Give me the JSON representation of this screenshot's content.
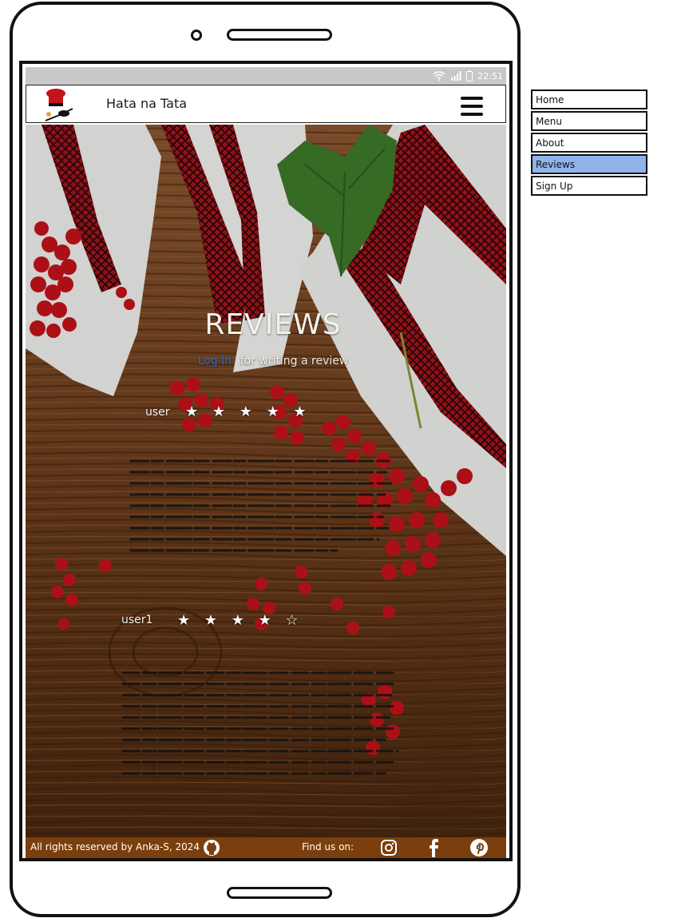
{
  "status_bar": {
    "time": "22:51"
  },
  "header": {
    "brand": "Hata na Tata"
  },
  "page": {
    "title": "REVIEWS",
    "login_link": "Log In",
    "login_suffix": "for writing a review"
  },
  "reviews": [
    {
      "user": "user",
      "rating": 5,
      "stars": "★ ★ ★ ★ ★"
    },
    {
      "user": "user1",
      "rating": 4,
      "stars": "★ ★ ★ ★ ☆"
    }
  ],
  "footer": {
    "copyright": "All rights reserved by Anka-S, 2024",
    "find_us": "Find us on:",
    "social_icons": [
      "github-icon",
      "instagram-icon",
      "facebook-icon",
      "pinterest-icon"
    ]
  },
  "nav_menu": {
    "items": [
      "Home",
      "Menu",
      "About",
      "Reviews",
      "Sign Up"
    ],
    "active": "Reviews"
  },
  "colors": {
    "footer_bg": "#7a3f0c",
    "nav_active": "#8fb4ec",
    "link": "#2c6cc9",
    "embroidery_red": "#b0141d",
    "wood": "#6b3d1c"
  }
}
